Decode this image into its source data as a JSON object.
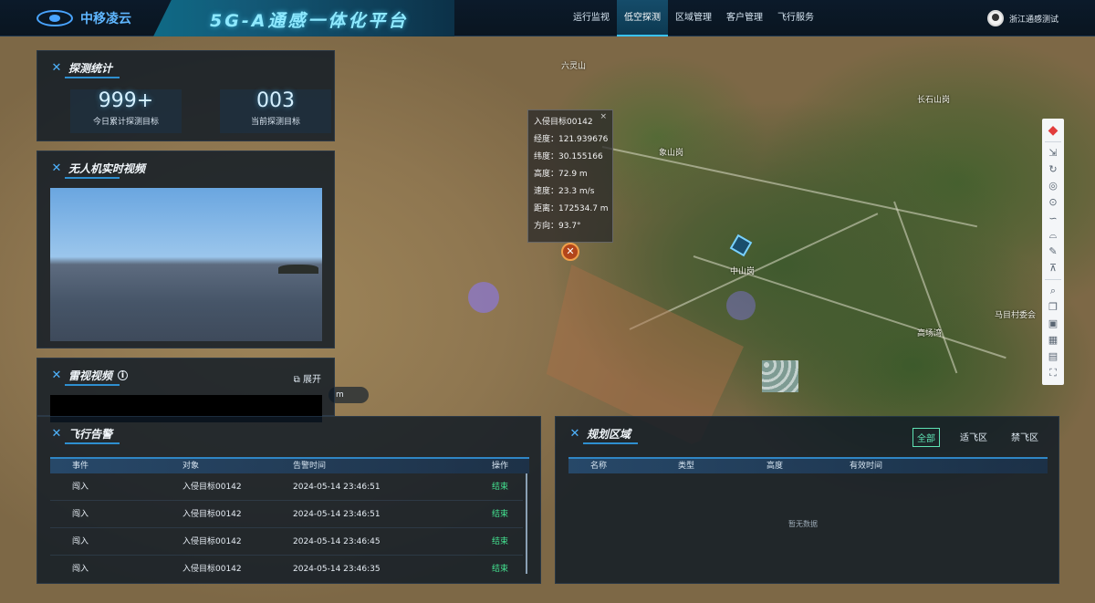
{
  "header": {
    "brand": "中移凌云",
    "title": "5G-A通感一体化平台",
    "nav": [
      "运行监视",
      "低空探测",
      "区域管理",
      "客户管理",
      "飞行服务"
    ],
    "active_nav": "低空探测",
    "user": "浙江通感测试"
  },
  "stats": {
    "title": "探测统计",
    "today_value": "999+",
    "today_label": "今日累计探测目标",
    "current_value": "003",
    "current_label": "当前探测目标"
  },
  "uav_video": {
    "title": "无人机实时视频"
  },
  "radar_video": {
    "title": "雷视视频",
    "expand_label": "展开"
  },
  "tooltip": {
    "target": "入侵目标00142",
    "close": "×",
    "rows": [
      "经度：121.939676",
      "纬度：30.155166",
      "高度：72.9 m",
      "速度：23.3 m/s",
      "距离：172534.7 m",
      "方向：93.7°"
    ]
  },
  "map": {
    "labels": [
      "六灵山",
      "象山岗",
      "中山岗",
      "高场湾",
      "马目村委会",
      "长石山岗"
    ],
    "scale": "m"
  },
  "alerts": {
    "title": "飞行告警",
    "columns": [
      "事件",
      "对象",
      "告警时间",
      "操作"
    ],
    "rows": [
      {
        "event": "闯入",
        "object": "入侵目标00142",
        "time": "2024-05-14 23:46:51",
        "op": "结束"
      },
      {
        "event": "闯入",
        "object": "入侵目标00142",
        "time": "2024-05-14 23:46:51",
        "op": "结束"
      },
      {
        "event": "闯入",
        "object": "入侵目标00142",
        "time": "2024-05-14 23:46:45",
        "op": "结束"
      },
      {
        "event": "闯入",
        "object": "入侵目标00142",
        "time": "2024-05-14 23:46:35",
        "op": "结束"
      }
    ]
  },
  "zones": {
    "title": "规划区域",
    "tabs": [
      "全部",
      "适飞区",
      "禁飞区"
    ],
    "active_tab": "全部",
    "columns": [
      "名称",
      "类型",
      "高度",
      "有效时间"
    ],
    "empty": "暂无数据"
  },
  "toolbar": {
    "icons": [
      "compass-icon",
      "export-icon",
      "refresh-icon",
      "layers-icon",
      "location-icon",
      "route-icon",
      "radar-icon",
      "edit-icon",
      "station-icon",
      "search-icon",
      "copy-icon",
      "image-icon",
      "grid-icon",
      "bag-icon",
      "fullscreen-icon"
    ]
  }
}
